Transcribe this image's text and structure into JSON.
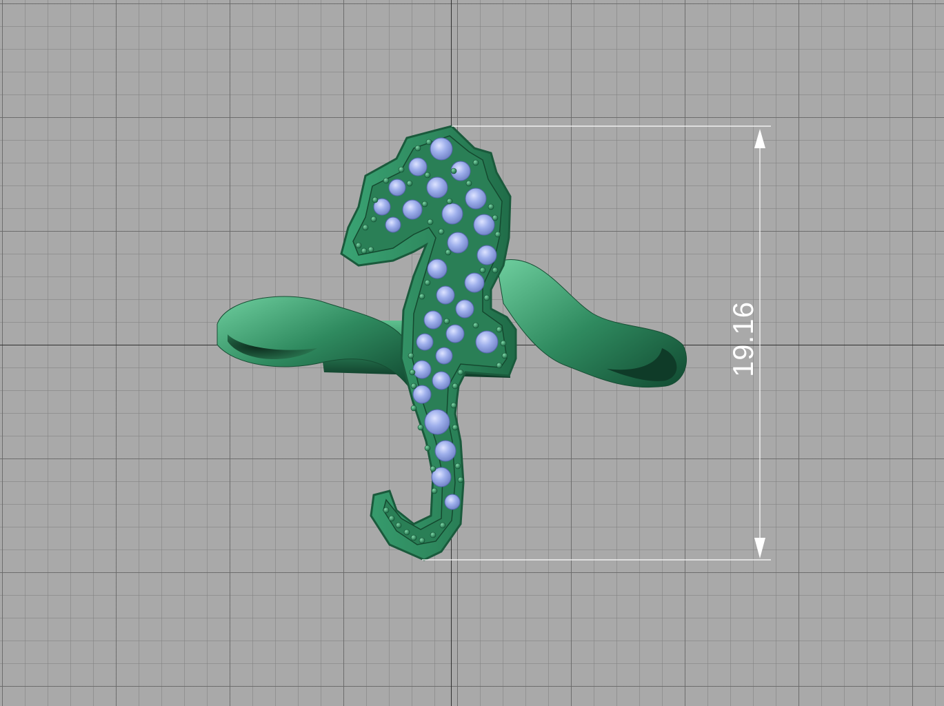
{
  "viewport": {
    "view": "front",
    "background_color": "#a9a9a9",
    "grid_minor_color": "#808080",
    "grid_major_color": "#696969",
    "axis_color": "#2e2e2e"
  },
  "model": {
    "metal_color": "#2f8a5f",
    "metal_dark": "#0f3b28",
    "metal_light": "#6fcf9f",
    "stone_color": "#8f9fe0",
    "stone_highlight": "#dde3ff"
  },
  "dimension": {
    "value": "19.16",
    "line_color": "#ffffff"
  }
}
